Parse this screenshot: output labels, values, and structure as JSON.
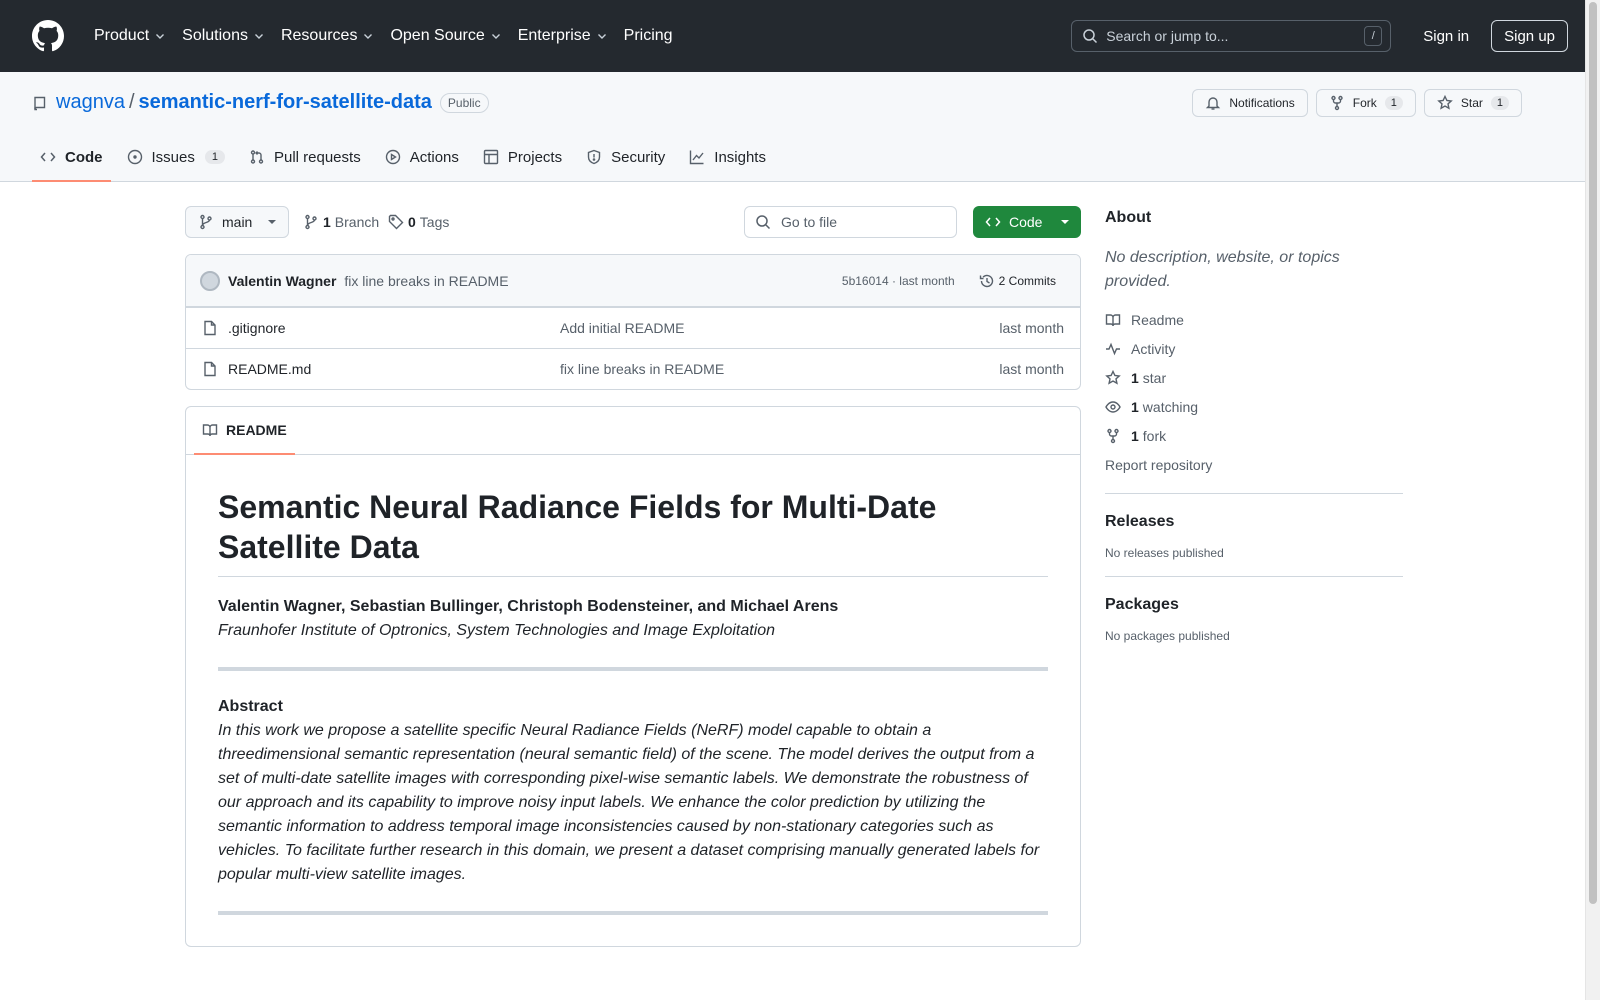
{
  "header": {
    "nav": [
      "Product",
      "Solutions",
      "Resources",
      "Open Source",
      "Enterprise",
      "Pricing"
    ],
    "search_placeholder": "Search or jump to...",
    "search_shortcut": "/",
    "sign_in": "Sign in",
    "sign_up": "Sign up"
  },
  "repo": {
    "owner": "wagnva",
    "separator": "/",
    "name": "semantic-nerf-for-satellite-data",
    "visibility": "Public",
    "actions": {
      "notifications": "Notifications",
      "fork_label": "Fork",
      "fork_count": "1",
      "star_label": "Star",
      "star_count": "1"
    },
    "tabs": [
      {
        "label": "Code",
        "icon": "code-icon"
      },
      {
        "label": "Issues",
        "count": "1",
        "icon": "issue-icon"
      },
      {
        "label": "Pull requests",
        "icon": "pull-request-icon"
      },
      {
        "label": "Actions",
        "icon": "play-icon"
      },
      {
        "label": "Projects",
        "icon": "table-icon"
      },
      {
        "label": "Security",
        "icon": "shield-icon"
      },
      {
        "label": "Insights",
        "icon": "graph-icon"
      }
    ]
  },
  "toolbar": {
    "branch": "main",
    "branch_count": "1",
    "branch_label": "Branch",
    "tag_count": "0",
    "tag_label": "Tags",
    "go_to_file": "Go to file",
    "code_button": "Code"
  },
  "latest_commit": {
    "author": "Valentin Wagner",
    "message": "fix line breaks in README",
    "meta": "5b16014 · last month",
    "commits": "2 Commits"
  },
  "files": [
    {
      "name": ".gitignore",
      "message": "Add initial README",
      "date": "last month"
    },
    {
      "name": "README.md",
      "message": "fix line breaks in README",
      "date": "last month"
    }
  ],
  "readme": {
    "tab": "README",
    "title": "Semantic Neural Radiance Fields for Multi-Date Satellite Data",
    "authors": "Valentin Wagner, Sebastian Bullinger, Christoph Bodensteiner, and Michael Arens",
    "institute": "Fraunhofer Institute of Optronics, System Technologies and Image Exploitation",
    "abstract_title": "Abstract",
    "abstract": "In this work we propose a satellite specific Neural Radiance Fields (NeRF) model capable to obtain a threedimensional semantic representation (neural semantic field) of the scene. The model derives the output from a set of multi-date satellite images with corresponding pixel-wise semantic labels. We demonstrate the robustness of our approach and its capability to improve noisy input labels. We enhance the color prediction by utilizing the semantic information to address temporal image inconsistencies caused by non-stationary categories such as vehicles. To facilitate further research in this domain, we present a dataset comprising manually generated labels for popular multi-view satellite images."
  },
  "sidebar": {
    "about_title": "About",
    "description": "No description, website, or topics provided.",
    "readme": "Readme",
    "activity": "Activity",
    "stars_count": "1",
    "stars_label": "star",
    "watching_count": "1",
    "watching_label": "watching",
    "forks_count": "1",
    "forks_label": "fork",
    "report": "Report repository",
    "releases_title": "Releases",
    "releases_text": "No releases published",
    "packages_title": "Packages",
    "packages_text": "No packages published"
  },
  "colors": {
    "header_bg": "#24292f",
    "link": "#0969da",
    "code_button": "#1f883d",
    "tab_underline": "#fd8c73"
  }
}
